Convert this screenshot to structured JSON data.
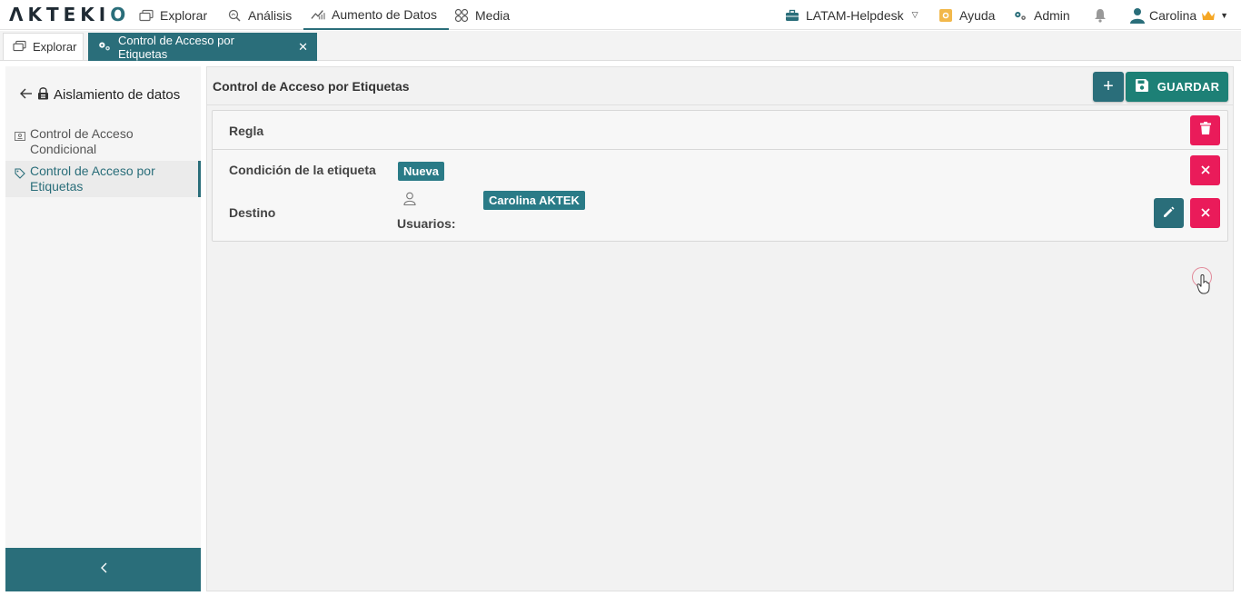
{
  "brand": {
    "logo_text": "AKTEKIO"
  },
  "nav": {
    "items": [
      {
        "label": "Explorar",
        "icon": "explore-icon"
      },
      {
        "label": "Análisis",
        "icon": "analysis-icon"
      },
      {
        "label": "Aumento de Datos",
        "icon": "data-augmentation-icon",
        "active": true
      },
      {
        "label": "Media",
        "icon": "media-icon"
      }
    ],
    "right": {
      "workspace": "LATAM-Helpdesk",
      "help": "Ayuda",
      "admin": "Admin",
      "user": "Carolina"
    }
  },
  "tabs": [
    {
      "label": "Explorar"
    },
    {
      "label": "Control de Acceso por Etiquetas",
      "active": true
    }
  ],
  "sidebar": {
    "header": "Aislamiento de datos",
    "items": [
      {
        "label": "Control de Acceso Condicional"
      },
      {
        "label": "Control de Acceso por Etiquetas",
        "active": true
      }
    ]
  },
  "main": {
    "title": "Control de Acceso por Etiquetas",
    "save_label": "GUARDAR",
    "plus_label": "+",
    "rule": {
      "title": "Regla",
      "condition_label": "Condición de la etiqueta",
      "condition_tag": "Nueva",
      "target_label": "Destino",
      "users_label": "Usuarios:",
      "user_chip": "Carolina AKTEK"
    }
  },
  "colors": {
    "primary": "#2a6e7a",
    "save": "#1d8076",
    "danger": "#ea1b5a",
    "crown": "#f5a623"
  }
}
